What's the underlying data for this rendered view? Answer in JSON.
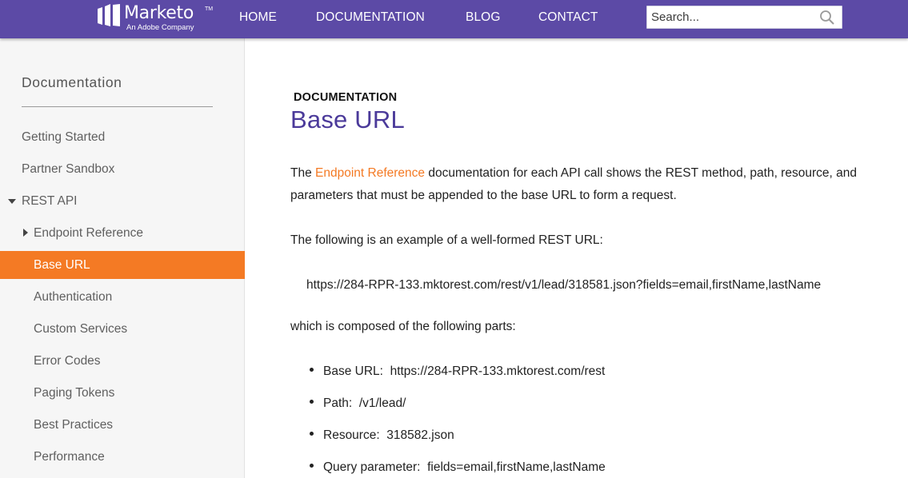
{
  "brand": {
    "name": "Marketo",
    "trademark": "TM",
    "tagline": "An Adobe Company"
  },
  "nav": {
    "items": [
      {
        "label": "HOME"
      },
      {
        "label": "DOCUMENTATION"
      },
      {
        "label": "BLOG"
      },
      {
        "label": "CONTACT"
      }
    ],
    "search_placeholder": "Search..."
  },
  "sidebar": {
    "title": "Documentation",
    "items": [
      {
        "label": "Getting Started",
        "level": 0
      },
      {
        "label": "Partner Sandbox",
        "level": 0
      },
      {
        "label": "REST API",
        "level": 0,
        "expanded": true
      },
      {
        "label": "Endpoint Reference",
        "level": 1,
        "expanded": false
      },
      {
        "label": "Base URL",
        "level": 1,
        "active": true
      },
      {
        "label": "Authentication",
        "level": 1
      },
      {
        "label": "Custom Services",
        "level": 1
      },
      {
        "label": "Error Codes",
        "level": 1
      },
      {
        "label": "Paging Tokens",
        "level": 1
      },
      {
        "label": "Best Practices",
        "level": 1
      },
      {
        "label": "Performance",
        "level": 1
      }
    ]
  },
  "content": {
    "eyebrow": "DOCUMENTATION",
    "title": "Base URL",
    "intro_prefix": "The ",
    "intro_link": "Endpoint Reference",
    "intro_line1_suffix": " documentation for each API call shows the REST method, path, resource, and",
    "intro_line2": "parameters that must be appended to the base URL to form a request.",
    "example_intro": "The following is an example of a well-formed REST URL:",
    "example_url": "https://284-RPR-133.mktorest.com/rest/v1/lead/318581.json?fields=email,firstName,lastName",
    "parts_intro": "which is composed of the following parts:",
    "parts": [
      {
        "label": "Base URL:",
        "value": "https://284-RPR-133.mktorest.com/rest"
      },
      {
        "label": "Path:",
        "value": "/v1/lead/"
      },
      {
        "label": "Resource:",
        "value": "318582.json"
      },
      {
        "label": "Query parameter:",
        "value": "fields=email,firstName,lastName"
      }
    ]
  },
  "colors": {
    "header_bg": "#5c4aa6",
    "accent_orange": "#f47a24",
    "title_purple": "#4b3a9a",
    "sidebar_bg": "#f6f6f6"
  }
}
